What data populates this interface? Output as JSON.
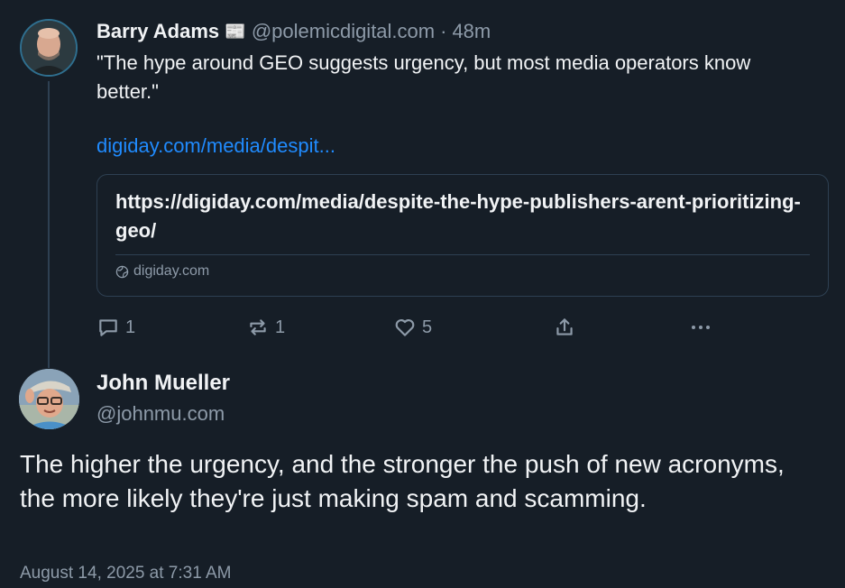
{
  "post": {
    "author_name": "Barry Adams",
    "author_badge_icon": "newspaper-icon",
    "handle": "@polemicdigital.com",
    "separator": "·",
    "time": "48m",
    "text": "\"The hype around GEO suggests urgency, but most media operators know better.\"",
    "link_text": "digiday.com/media/despit...",
    "card": {
      "title": "https://digiday.com/media/despite-the-hype-publishers-arent-prioritizing-geo/",
      "domain": "digiday.com",
      "domain_icon": "globe-icon"
    },
    "actions": {
      "reply_count": "1",
      "repost_count": "1",
      "like_count": "5"
    }
  },
  "reply": {
    "author_name": "John Mueller",
    "handle": "@johnmu.com",
    "text": "The higher the urgency, and the stronger the push of new acronyms, the more likely they're just making spam and scamming.",
    "date": "August 14, 2025 at 7:31 AM"
  },
  "colors": {
    "background": "#161e27",
    "text": "#f1f3f5",
    "muted": "#8d9aa8",
    "link": "#208bfe",
    "border": "#2e4052"
  }
}
